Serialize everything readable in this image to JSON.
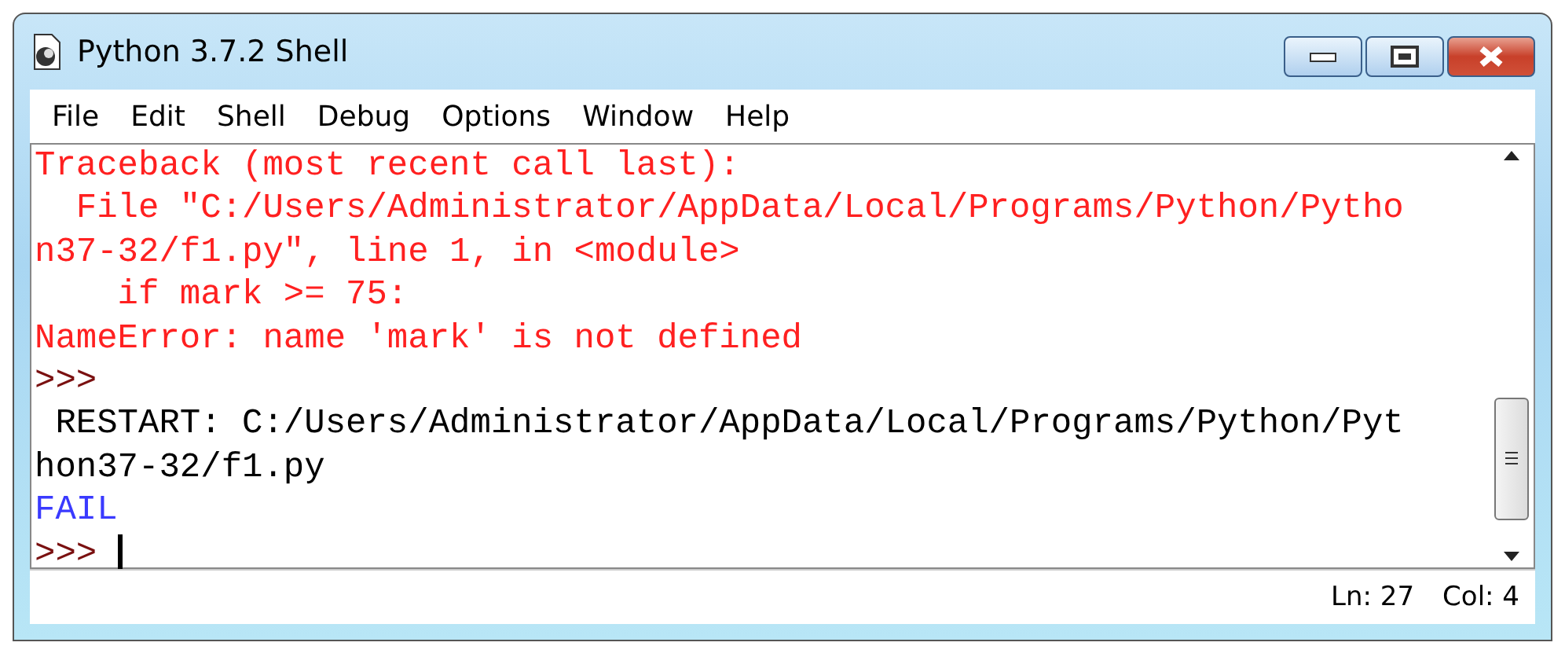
{
  "window": {
    "title": "Python 3.7.2 Shell"
  },
  "menu": [
    "File",
    "Edit",
    "Shell",
    "Debug",
    "Options",
    "Window",
    "Help"
  ],
  "lines": [
    {
      "kind": "error",
      "text": "Traceback (most recent call last):"
    },
    {
      "kind": "error",
      "text": "  File \"C:/Users/Administrator/AppData/Local/Programs/Python/Pytho"
    },
    {
      "kind": "error",
      "text": "n37-32/f1.py\", line 1, in <module>"
    },
    {
      "kind": "error",
      "text": "    if mark >= 75:"
    },
    {
      "kind": "error",
      "text": "NameError: name 'mark' is not defined"
    },
    {
      "kind": "prompt",
      "text": ">>>"
    },
    {
      "kind": "output",
      "text": " RESTART: C:/Users/Administrator/AppData/Local/Programs/Python/Pyt"
    },
    {
      "kind": "output",
      "text": "hon37-32/f1.py"
    },
    {
      "kind": "stdout",
      "text": "FAIL"
    },
    {
      "kind": "prompt",
      "text": ">>> ",
      "cursor": true
    }
  ],
  "status_bar": {
    "line": "Ln: 27",
    "column": "Col: 4"
  }
}
